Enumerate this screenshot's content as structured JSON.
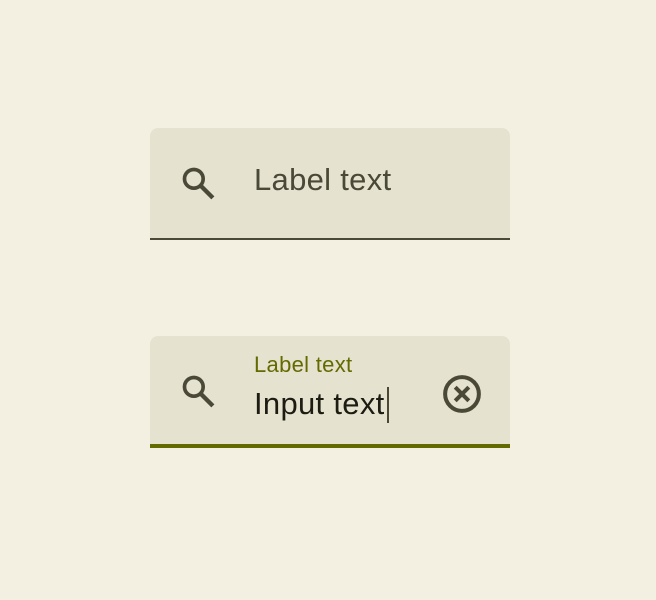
{
  "fields": [
    {
      "label": "Label text",
      "state": "resting",
      "leading_icon": "search-icon"
    },
    {
      "label": "Label text",
      "value": "Input text",
      "state": "focused",
      "leading_icon": "search-icon",
      "trailing_icon": "clear-icon"
    }
  ],
  "colors": {
    "background": "#f3f0e2",
    "field_fill": "#e5e2cf",
    "on_surface_variant": "#4a4837",
    "primary": "#636b00",
    "on_surface": "#1d1c12"
  }
}
